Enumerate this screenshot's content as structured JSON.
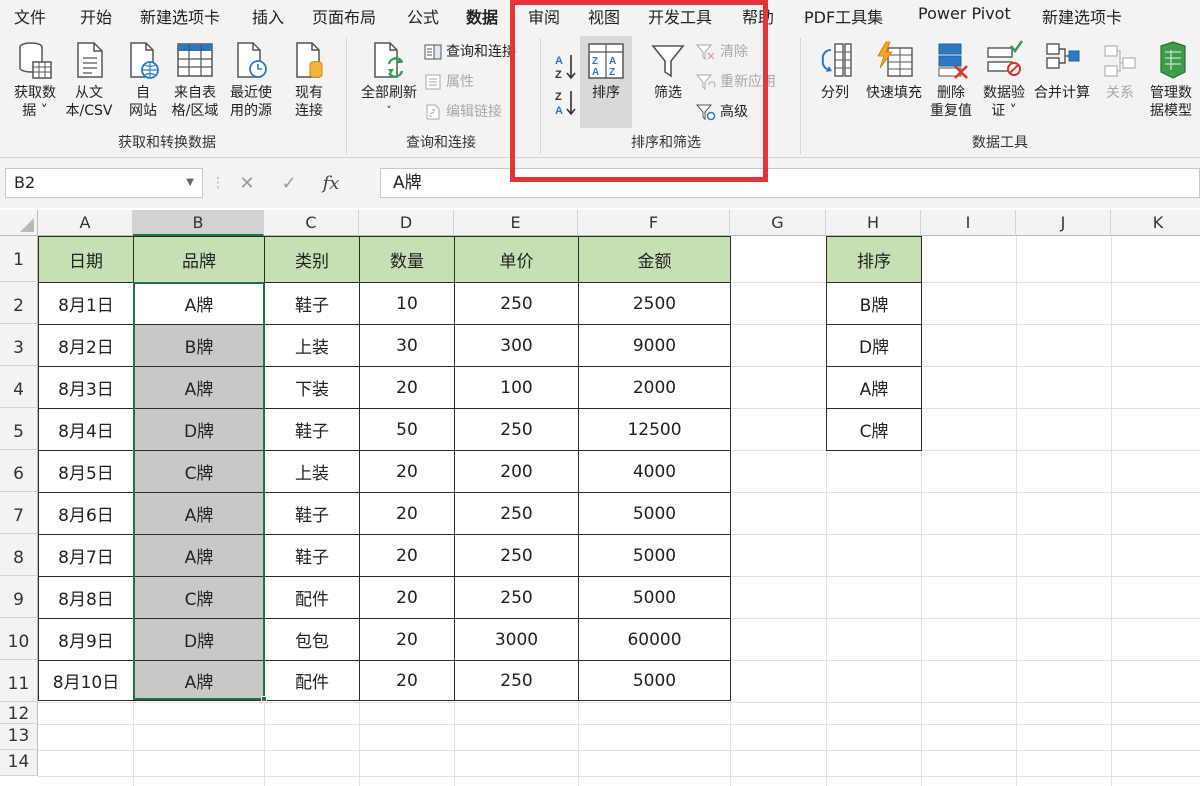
{
  "ribbon_tabs": [
    "文件",
    "开始",
    "新建选项卡",
    "插入",
    "页面布局",
    "公式",
    "数据",
    "审阅",
    "视图",
    "开发工具",
    "帮助",
    "PDF工具集",
    "Power Pivot",
    "新建选项卡"
  ],
  "active_tab": "数据",
  "groups": {
    "get_transform": {
      "label": "获取和转换数据",
      "get_data": [
        "获取数",
        "据 ˅"
      ],
      "from_text": [
        "从文",
        "本/CSV"
      ],
      "from_web": [
        "自",
        "网站"
      ],
      "from_table": [
        "来自表",
        "格/区域"
      ],
      "recent_sources": [
        "最近使",
        "用的源"
      ],
      "existing_connections": [
        "现有",
        "连接"
      ]
    },
    "queries": {
      "label": "查询和连接",
      "refresh_all": [
        "全部刷新",
        "˅"
      ],
      "queries_connections": "查询和连接",
      "properties": "属性",
      "edit_links": "编辑链接"
    },
    "sort_filter": {
      "label": "排序和筛选",
      "sort": "排序",
      "filter": "筛选",
      "clear": "清除",
      "reapply": "重新应用",
      "advanced": "高级"
    },
    "data_tools": {
      "label": "数据工具",
      "text_to_columns": "分列",
      "flash_fill": "快速填充",
      "remove_duplicates": [
        "删除",
        "重复值"
      ],
      "data_validation": [
        "数据验",
        "证 ˅"
      ],
      "consolidate": "合并计算",
      "relationships": "关系",
      "manage_model": [
        "管理数",
        "据模型"
      ]
    }
  },
  "formula_bar": {
    "name_box": "B2",
    "formula": "A牌",
    "cancel": "✕",
    "enter": "✓",
    "fx": "fx"
  },
  "columns": [
    "A",
    "B",
    "C",
    "D",
    "E",
    "F",
    "G",
    "H",
    "I",
    "J",
    "K"
  ],
  "rows": [
    "1",
    "2",
    "3",
    "4",
    "5",
    "6",
    "7",
    "8",
    "9",
    "10",
    "11",
    "12",
    "13",
    "14"
  ],
  "table": {
    "headers": [
      "日期",
      "品牌",
      "类别",
      "数量",
      "单价",
      "金额"
    ],
    "rows": [
      [
        "8月1日",
        "A牌",
        "鞋子",
        "10",
        "250",
        "2500"
      ],
      [
        "8月2日",
        "B牌",
        "上装",
        "30",
        "300",
        "9000"
      ],
      [
        "8月3日",
        "A牌",
        "下装",
        "20",
        "100",
        "2000"
      ],
      [
        "8月4日",
        "D牌",
        "鞋子",
        "50",
        "250",
        "12500"
      ],
      [
        "8月5日",
        "C牌",
        "上装",
        "20",
        "200",
        "4000"
      ],
      [
        "8月6日",
        "A牌",
        "鞋子",
        "20",
        "250",
        "5000"
      ],
      [
        "8月7日",
        "A牌",
        "鞋子",
        "20",
        "250",
        "5000"
      ],
      [
        "8月8日",
        "C牌",
        "配件",
        "20",
        "250",
        "5000"
      ],
      [
        "8月9日",
        "D牌",
        "包包",
        "20",
        "3000",
        "60000"
      ],
      [
        "8月10日",
        "A牌",
        "配件",
        "20",
        "250",
        "5000"
      ]
    ]
  },
  "sort_order": {
    "header": "排序",
    "items": [
      "B牌",
      "D牌",
      "A牌",
      "C牌"
    ]
  },
  "colors": {
    "header_fill": "#c6e0b4",
    "selection_gray": "#c8c8c8",
    "excel_green": "#217346",
    "highlight_red": "#e5333a"
  }
}
